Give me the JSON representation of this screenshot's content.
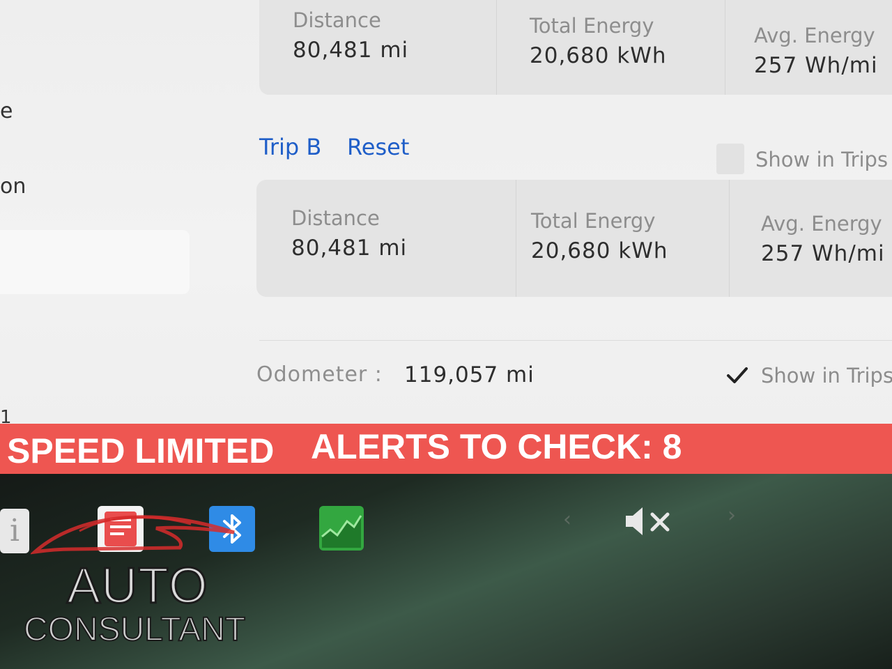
{
  "left_sidebar": {
    "fragments": [
      "e",
      "on",
      "1"
    ]
  },
  "trip_a": {
    "stats": [
      {
        "label": "Distance",
        "value": "80,481 mi"
      },
      {
        "label": "Total Energy",
        "value": "20,680 kWh"
      },
      {
        "label": "Avg. Energy",
        "value": "257 Wh/mi"
      }
    ]
  },
  "trip_b": {
    "title": "Trip B",
    "reset_label": "Reset",
    "show_in_trips_label": "Show in Trips",
    "show_in_trips_checked": false,
    "stats": [
      {
        "label": "Distance",
        "value": "80,481 mi"
      },
      {
        "label": "Total Energy",
        "value": "20,680 kWh"
      },
      {
        "label": "Avg. Energy",
        "value": "257 Wh/mi"
      }
    ]
  },
  "odometer": {
    "label": "Odometer  :",
    "value": "119,057 mi",
    "show_in_trips_label": "Show in Trips",
    "show_in_trips_checked": true
  },
  "alert_bar": {
    "speed_text": "SPEED LIMITED",
    "alerts_text": "ALERTS TO CHECK: 8",
    "color": "#ee5651"
  },
  "dock": {
    "icons": [
      "info-icon",
      "card-icon",
      "bluetooth-icon",
      "energy-chart-icon",
      "chevron-left-icon",
      "mute-icon",
      "chevron-right-icon"
    ],
    "info_glyph": "i",
    "left_arrow": "‹",
    "right_arrow": "›"
  },
  "watermark": {
    "line1": "AUTO",
    "line2": "CONSULTANT"
  }
}
